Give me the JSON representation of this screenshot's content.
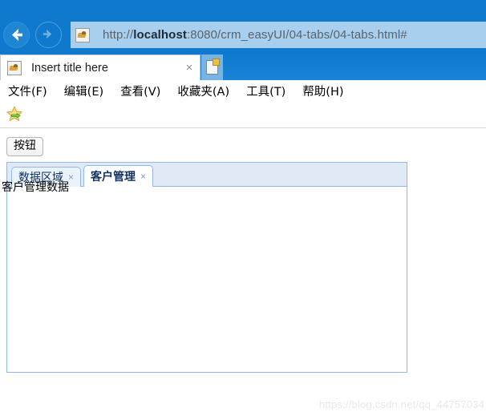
{
  "browser": {
    "back_label": "back-arrow",
    "forward_label": "forward-arrow",
    "url": "http://localhost:8080/crm_easyUI/04-tabs/04-tabs.html#",
    "url_host": "localhost",
    "url_prefix": "http://",
    "url_suffix": ":8080/crm_easyUI/04-tabs/04-tabs.html#",
    "tab_title": "Insert title here",
    "tab_close_label": "×",
    "new_tab_label": "new-tab",
    "chrome_color": "#0f79cd",
    "address_bar_color": "#a8cfed"
  },
  "menubar": {
    "items": [
      {
        "label": "文件(F)"
      },
      {
        "label": "编辑(E)"
      },
      {
        "label": "查看(V)"
      },
      {
        "label": "收藏夹(A)"
      },
      {
        "label": "工具(T)"
      },
      {
        "label": "帮助(H)"
      }
    ]
  },
  "favorites_bar": {
    "add_favorites_icon": "star-with-arrow-icon"
  },
  "page": {
    "button_label": "按钮",
    "tabs": {
      "items": [
        {
          "label": "数据区域",
          "close": "×",
          "active": false
        },
        {
          "label": "客户管理",
          "close": "×",
          "active": true
        }
      ],
      "active_index": 1,
      "content_text": "客户管理数据",
      "border_color": "#95b8e7",
      "header_bg": "#e0eaf7"
    }
  },
  "watermark": {
    "text": "https://blog.csdn.net/qq_44757034"
  }
}
